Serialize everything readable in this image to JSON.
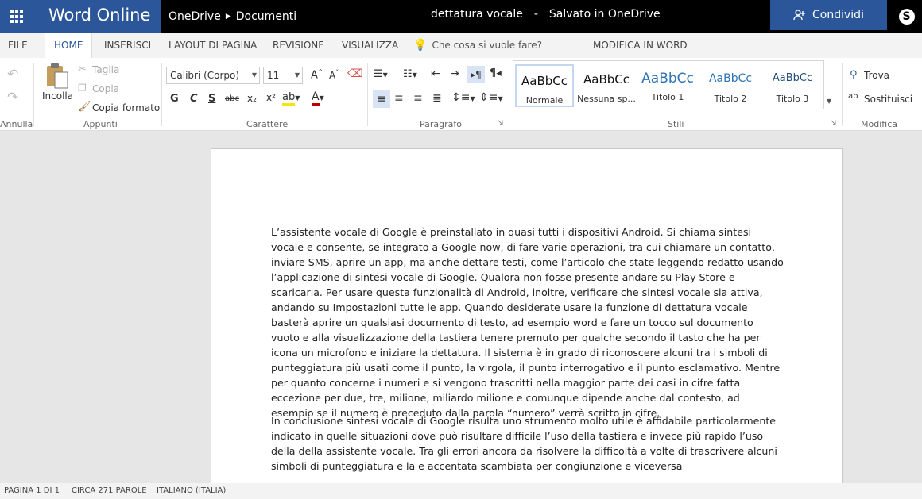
{
  "header": {
    "app_name": "Word Online",
    "breadcrumb": [
      "OneDrive",
      "Documenti"
    ],
    "doc_title": "dettatura vocale",
    "separator": "-",
    "save_status": "Salvato in OneDrive",
    "share_label": "Condividi"
  },
  "tabs": [
    {
      "label": "FILE"
    },
    {
      "label": "HOME"
    },
    {
      "label": "INSERISCI"
    },
    {
      "label": "LAYOUT DI PAGINA"
    },
    {
      "label": "REVISIONE"
    },
    {
      "label": "VISUALIZZA"
    },
    {
      "label": "MODIFICA IN WORD"
    }
  ],
  "tellme_placeholder": "Che cosa si vuole fare?",
  "ribbon": {
    "undo_group": "Annulla",
    "clipboard": {
      "paste": "Incolla",
      "cut": "Taglia",
      "copy": "Copia",
      "format_painter": "Copia formato",
      "group": "Appunti"
    },
    "font": {
      "family": "Calibri (Corpo)",
      "size": "11",
      "bold": "G",
      "italic": "C",
      "underline": "S",
      "strike": "abc",
      "subscript": "x₂",
      "superscript": "x²",
      "group": "Carattere"
    },
    "paragraph_group": "Paragrafo",
    "styles": {
      "sample": "AaBbCc",
      "items": [
        "Normale",
        "Nessuna sp...",
        "Titolo 1",
        "Titolo 2",
        "Titolo 3"
      ],
      "group": "Stili"
    },
    "editing": {
      "find": "Trova",
      "replace": "Sostituisci",
      "group": "Modifica"
    }
  },
  "document": {
    "paragraphs": [
      "L’assistente vocale di Google è preinstallato in quasi tutti i dispositivi Android. Si chiama sintesi vocale e consente, se integrato a Google now, di fare varie operazioni, tra cui chiamare un contatto, inviare SMS, aprire un app, ma anche dettare testi, come l’articolo che state leggendo redatto usando l’applicazione di sintesi vocale di Google. Qualora non fosse presente andare su Play Store e scaricarla. Per usare questa funzionalità di Android, inoltre, verificare che sintesi vocale sia attiva, andando su Impostazioni tutte le app. Quando desiderate usare la funzione di dettatura vocale basterà aprire un qualsiasi documento di testo, ad esempio word e fare un tocco sul documento vuoto e alla visualizzazione della tastiera tenere premuto per qualche secondo il tasto che ha per icona un microfono e iniziare la dettatura. Il sistema è in grado di riconoscere alcuni tra i simboli di punteggiatura più usati come il punto, la virgola, il punto interrogativo e il punto esclamativo. Mentre per quanto concerne i numeri e si vengono trascritti nella maggior parte dei casi in cifre fatta eccezione per due, tre, milione, miliardo milione e comunque dipende anche dal contesto, ad esempio se il numero è preceduto dalla parola “numero” verrà scritto in cifre.",
      "In conclusione sintesi vocale di Google risulta uno strumento molto utile è affidabile particolarmente indicato in quelle situazioni dove può risultare difficile l’uso della tastiera e invece più rapido l’uso della della assistente vocale. Tra gli errori ancora da risolvere la difficoltà a volte di trascrivere alcuni simboli di punteggiatura e la e accentata scambiata per congiunzione e viceversa"
    ]
  },
  "status": {
    "page": "PAGINA 1 DI 1",
    "words": "CIRCA 271 PAROLE",
    "language": "ITALIANO (ITALIA)"
  },
  "colors": {
    "brand": "#2b579a",
    "heading": "#2e74b5"
  }
}
